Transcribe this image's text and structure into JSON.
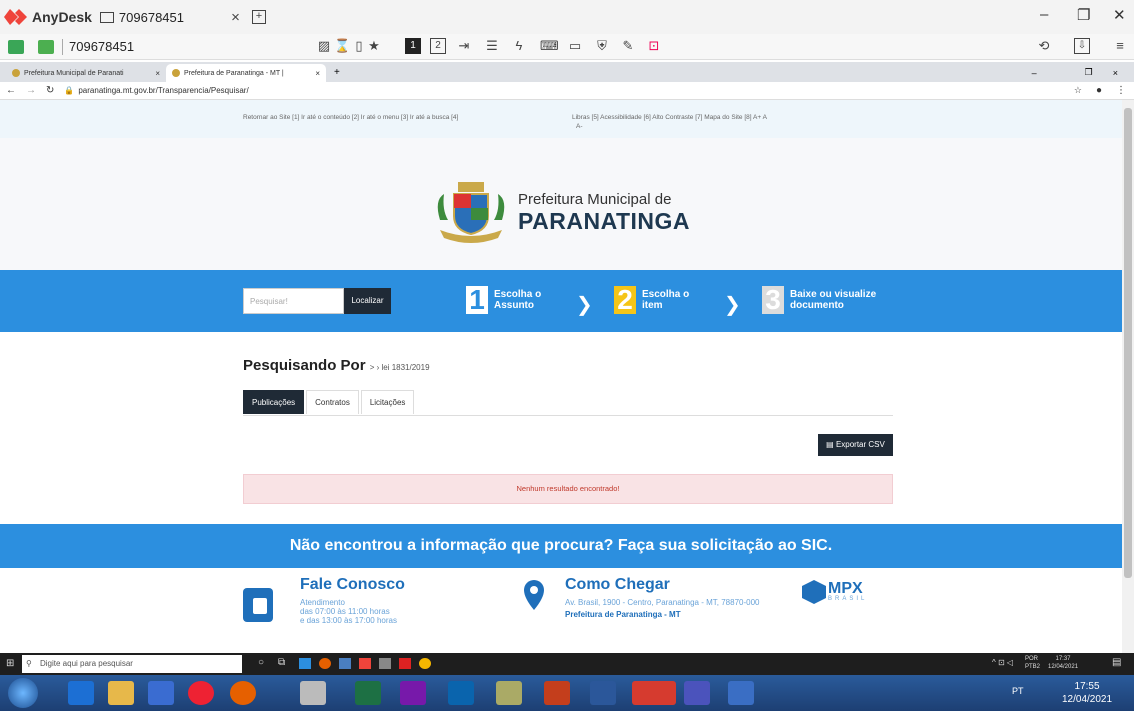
{
  "anydesk": {
    "app_name": "AnyDesk",
    "tab_id": "709678451",
    "session_id": "709678451",
    "toolbar_numbers": [
      "1",
      "2"
    ]
  },
  "browser": {
    "tabs": [
      {
        "label": "Prefeitura Municipal de Paranati",
        "active": false
      },
      {
        "label": "Prefeitura de Paranatinga - MT |",
        "active": true
      }
    ],
    "new_tab": "+",
    "url": "paranatinga.mt.gov.br/Transparencia/Pesquisar/"
  },
  "accessibility": {
    "left_links": "Retornar ao Site [1]   Ir até o conteúdo [2]   Ir até o menu [3]   Ir até a busca [4]",
    "right_links": "Libras [5]   Acessibilidade [6]   Alto Contraste [7]   Mapa do Site [8]   A+   A",
    "right_links_2": "A-"
  },
  "brand": {
    "subtitle": "Prefeitura Municipal de",
    "title": "PARANATINGA"
  },
  "search": {
    "placeholder": "Pesquisar!",
    "button": "Localizar"
  },
  "steps": [
    {
      "num": "1",
      "line1": "Escolha o",
      "line2": "Assunto"
    },
    {
      "num": "2",
      "line1": "Escolha o",
      "line2": "item"
    },
    {
      "num": "3",
      "line1": "Baixe ou visualize",
      "line2": "documento"
    }
  ],
  "content": {
    "heading": "Pesquisando Por",
    "crumb": "> › lei 1831/2019",
    "tabs": [
      "Publicações",
      "Contratos",
      "Licitações"
    ],
    "export": "Exportar CSV",
    "empty": "Nenhum resultado encontrado!"
  },
  "sic": {
    "text": "Não encontrou a informação que procura? Faça sua solicitação ao SIC."
  },
  "footer": {
    "contact_title": "Fale Conosco",
    "contact_l1": "Atendimento",
    "contact_l2": "das 07:00 às 11:00 horas",
    "contact_l3": "e das 13:00 às 17:00 horas",
    "map_title": "Como Chegar",
    "map_address": "Av. Brasil, 1900 - Centro, Paranatinga - MT, 78870-000",
    "map_name": "Prefeitura de Paranatinga - MT",
    "partner": "MPX",
    "partner_sub": "BRASIL"
  },
  "taskbar_remote": {
    "search_placeholder": "Digite aqui para pesquisar",
    "lang": "POR",
    "layout": "PTB2",
    "time": "17:37",
    "date": "12/04/2021"
  },
  "taskbar_local": {
    "lang": "PT",
    "time": "17:55",
    "date": "12/04/2021"
  }
}
